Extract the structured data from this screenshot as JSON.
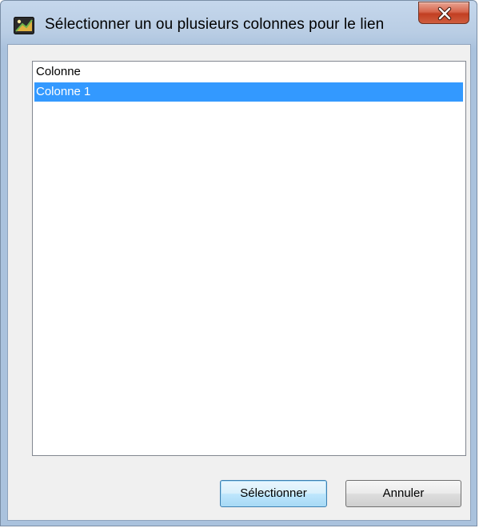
{
  "window": {
    "title": "Sélectionner un ou plusieurs colonnes pour le lien",
    "app_icon": "app-icon",
    "close_icon": "close-icon"
  },
  "list": {
    "header": "Colonne",
    "items": [
      {
        "label": "Colonne 1",
        "selected": true
      }
    ]
  },
  "buttons": {
    "select_label": "Sélectionner",
    "cancel_label": "Annuler"
  },
  "colors": {
    "selection": "#3399ff",
    "close_button": "#c23f22"
  }
}
